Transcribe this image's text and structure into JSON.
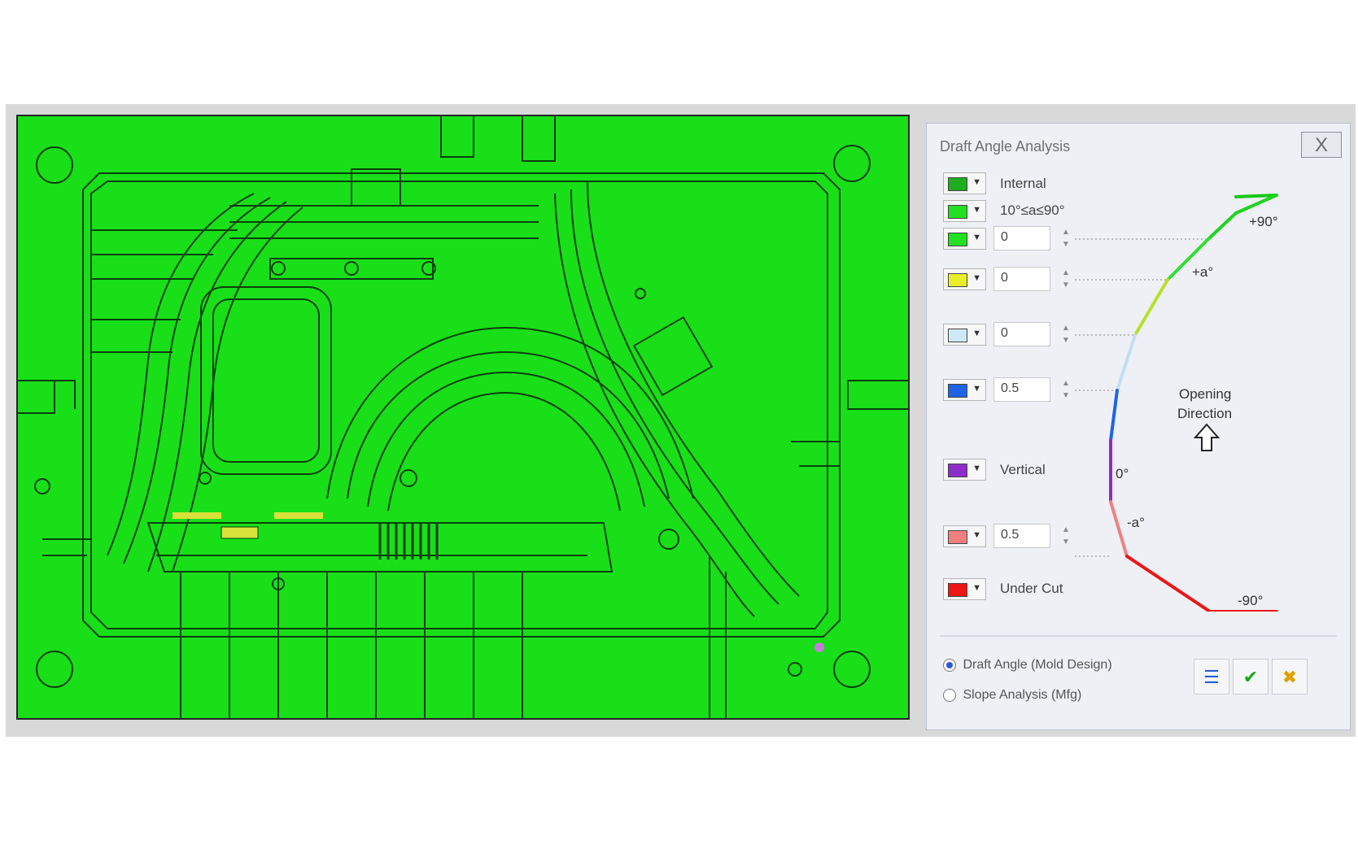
{
  "dialog": {
    "title": "Draft Angle Analysis",
    "close_label": "X"
  },
  "rows": [
    {
      "color": "#1fae1f",
      "label": "Internal"
    },
    {
      "color": "#22e022",
      "label": "10°≤a≤90°"
    },
    {
      "color": "#22e022",
      "value": "0"
    },
    {
      "color": "#e8ef2a",
      "value": "0"
    },
    {
      "color": "#cfe8f7",
      "value": "0"
    },
    {
      "color": "#1f63e8",
      "value": "0.5"
    },
    {
      "color": "#8e2cc9",
      "label": "Vertical"
    },
    {
      "color": "#f08080",
      "value": "0.5"
    },
    {
      "color": "#ee1515",
      "label": "Under Cut"
    }
  ],
  "gauge": {
    "labels": {
      "plus90": "+90°",
      "plus_a": "+a°",
      "zero": "0°",
      "minus_a": "-a°",
      "minus90": "-90°"
    },
    "direction_line1": "Opening",
    "direction_line2": "Direction"
  },
  "mode": {
    "options": [
      "Draft Angle (Mold Design)",
      "Slope Analysis (Mfg)"
    ],
    "selected_index": 0
  },
  "toolbar": {
    "icons": [
      "settings-icon",
      "apply-check-icon",
      "cancel-icon"
    ]
  },
  "colors": {
    "model_green": "#18df18",
    "outline": "#0a3a0a",
    "yellow_region": "#d8e23a",
    "purple_point": "#c97bdc"
  }
}
